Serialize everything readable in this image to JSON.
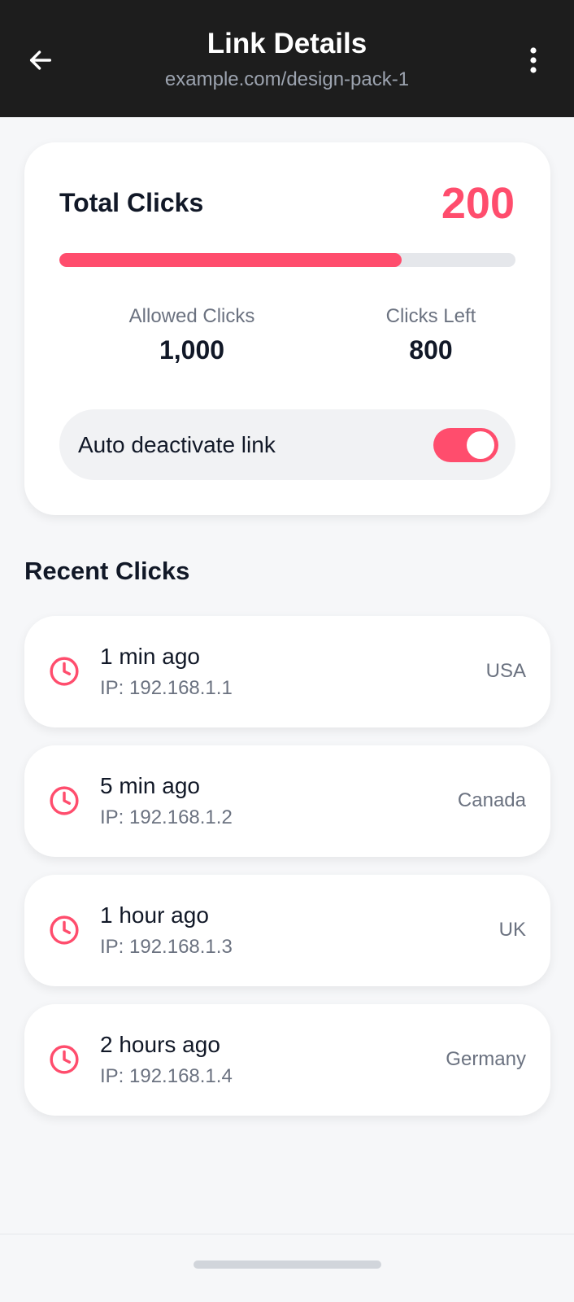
{
  "header": {
    "title": "Link Details",
    "subtitle": "example.com/design-pack-1",
    "back_icon": "arrow-left-icon",
    "menu_icon": "more-vertical-icon"
  },
  "stats": {
    "total_label": "Total Clicks",
    "total_value": "200",
    "progress_fraction": 0.75,
    "allowed_label": "Allowed Clicks",
    "allowed_value": "1,000",
    "left_label": "Clicks Left",
    "left_value": "800",
    "toggle_label": "Auto deactivate link",
    "toggle_on": true
  },
  "recent": {
    "title": "Recent Clicks",
    "items": [
      {
        "time": "1 min ago",
        "ip": "IP: 192.168.1.1",
        "country": "USA"
      },
      {
        "time": "5 min ago",
        "ip": "IP: 192.168.1.2",
        "country": "Canada"
      },
      {
        "time": "1 hour ago",
        "ip": "IP: 192.168.1.3",
        "country": "UK"
      },
      {
        "time": "2 hours ago",
        "ip": "IP: 192.168.1.4",
        "country": "Germany"
      }
    ]
  },
  "colors": {
    "accent": "#ff4d6d",
    "header_bg": "#1d1d1d",
    "page_bg": "#f6f7f9",
    "muted_text": "#6b7280"
  }
}
